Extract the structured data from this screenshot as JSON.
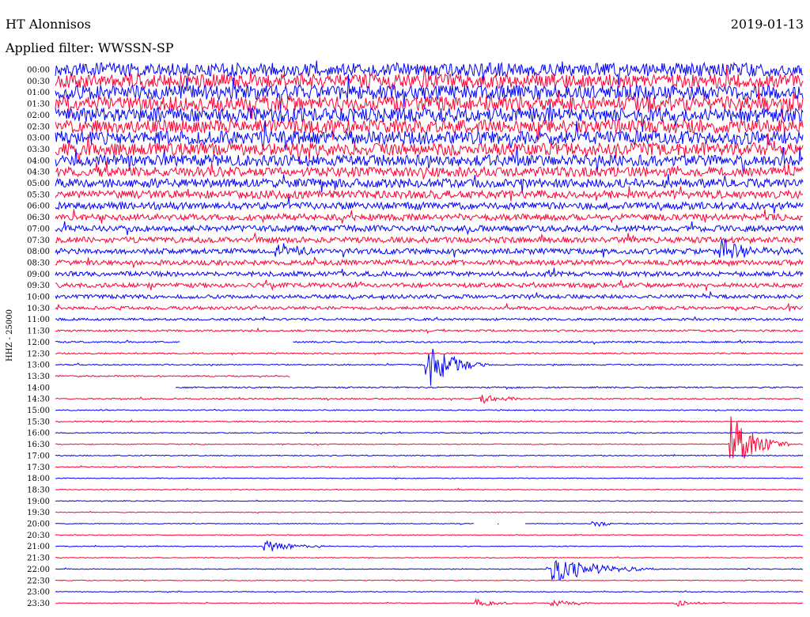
{
  "header": {
    "station": "HT Alonnisos",
    "date": "2019-01-13",
    "filter": "Applied filter: WWSSN-SP"
  },
  "side_label": "HHZ - 25000",
  "colors": {
    "blue": "#0000ff",
    "red": "#ff0033",
    "background": "#ffffff"
  },
  "chart_data": {
    "type": "line",
    "title": "HT Alonnisos",
    "subtitle": "Applied filter: WWSSN-SP",
    "ylabel": "HHZ - 25000",
    "y_tick_labels": [
      "00:00",
      "00:30",
      "01:00",
      "01:30",
      "02:00",
      "02:30",
      "03:00",
      "03:30",
      "04:00",
      "04:30",
      "05:00",
      "05:30",
      "06:00",
      "06:30",
      "07:00",
      "07:30",
      "08:00",
      "08:30",
      "09:00",
      "09:30",
      "10:00",
      "10:30",
      "11:00",
      "11:30",
      "12:00",
      "12:30",
      "13:00",
      "13:30",
      "14:00",
      "14:30",
      "15:00",
      "15:30",
      "16:00",
      "16:30",
      "17:00",
      "17:30",
      "18:00",
      "18:30",
      "19:00",
      "19:30",
      "20:00",
      "20:30",
      "21:00",
      "21:30",
      "22:00",
      "22:30",
      "23:00",
      "23:30"
    ],
    "trace_colors": [
      "#0000ff",
      "#ff0033"
    ],
    "x_range_minutes": [
      0,
      30
    ],
    "noise_level_by_trace": [
      0.85,
      0.9,
      0.9,
      0.9,
      0.9,
      0.85,
      0.85,
      0.8,
      0.7,
      0.6,
      0.55,
      0.5,
      0.45,
      0.4,
      0.38,
      0.36,
      0.34,
      0.32,
      0.3,
      0.28,
      0.24,
      0.2,
      0.14,
      0.12,
      0.1,
      0.09,
      0.08,
      0.08,
      0.08,
      0.08,
      0.07,
      0.07,
      0.06,
      0.06,
      0.06,
      0.06,
      0.05,
      0.05,
      0.05,
      0.05,
      0.05,
      0.05,
      0.05,
      0.05,
      0.05,
      0.05,
      0.05,
      0.05
    ],
    "events": [
      {
        "trace": "08:00",
        "minute": 8.8,
        "amplitude": 1.2,
        "duration": 0.6
      },
      {
        "trace": "08:00",
        "minute": 26.6,
        "amplitude": 1.4,
        "duration": 1.2
      },
      {
        "trace": "13:00",
        "minute": 14.8,
        "amplitude": 2.6,
        "duration": 0.9
      },
      {
        "trace": "14:30",
        "minute": 17.0,
        "amplitude": 0.5,
        "duration": 1.0
      },
      {
        "trace": "16:30",
        "minute": 27.0,
        "amplitude": 3.5,
        "duration": 0.8
      },
      {
        "trace": "20:00",
        "minute": 21.5,
        "amplitude": 0.4,
        "duration": 0.6
      },
      {
        "trace": "21:00",
        "minute": 8.3,
        "amplitude": 0.6,
        "duration": 1.0
      },
      {
        "trace": "22:00",
        "minute": 19.7,
        "amplitude": 1.4,
        "duration": 1.6
      },
      {
        "trace": "23:30",
        "minute": 16.8,
        "amplitude": 0.4,
        "duration": 0.8
      },
      {
        "trace": "23:30",
        "minute": 19.8,
        "amplitude": 0.4,
        "duration": 0.8
      },
      {
        "trace": "23:30",
        "minute": 24.8,
        "amplitude": 0.35,
        "duration": 0.6
      }
    ],
    "gaps": [
      {
        "trace": "12:00",
        "start_minute": 5.0,
        "end_minute": 9.5
      },
      {
        "trace": "13:30",
        "start_minute": 9.4,
        "end_minute": 30.0
      },
      {
        "trace": "14:00",
        "start_minute": 0.0,
        "end_minute": 4.8
      },
      {
        "trace": "20:00",
        "start_minute": 16.8,
        "end_minute": 17.7
      },
      {
        "trace": "20:00",
        "start_minute": 17.8,
        "end_minute": 18.8
      }
    ]
  }
}
